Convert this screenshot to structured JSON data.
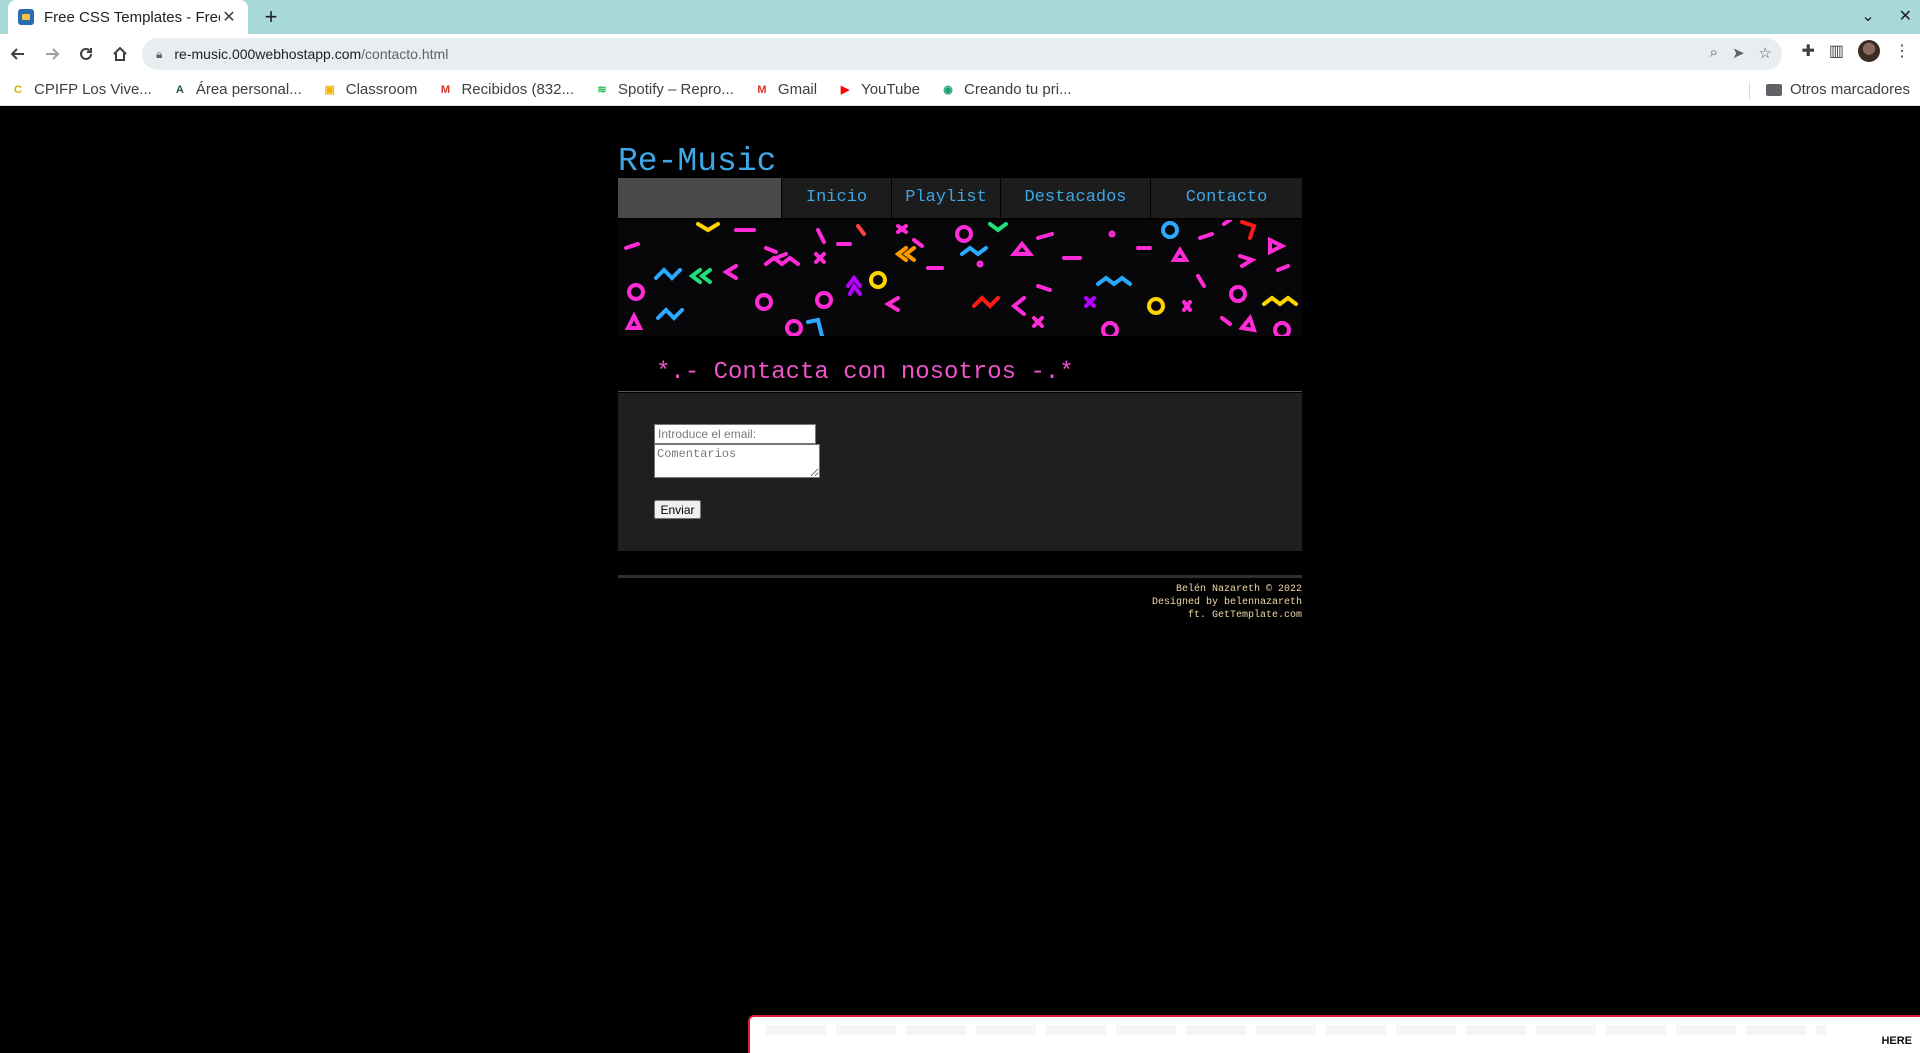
{
  "browser": {
    "tab_title": "Free CSS Templates - Free",
    "tab_close": "✕",
    "new_tab": "+",
    "url_host": "re-music.000webhostapp.com",
    "url_path": "/contacto.html",
    "bookmarks": [
      {
        "label": "CPIFP Los Vive...",
        "icon": "C",
        "color": "#e2a900"
      },
      {
        "label": "Área personal...",
        "icon": "A",
        "color": "#1e5631"
      },
      {
        "label": "Classroom",
        "icon": "▣",
        "color": "#f4b400"
      },
      {
        "label": "Recibidos (832...",
        "icon": "M",
        "color": "#d93025"
      },
      {
        "label": "Spotify – Repro...",
        "icon": "≋",
        "color": "#1db954"
      },
      {
        "label": "Gmail",
        "icon": "M",
        "color": "#d93025"
      },
      {
        "label": "YouTube",
        "icon": "▶",
        "color": "#ff0000"
      },
      {
        "label": "Creando tu pri...",
        "icon": "◉",
        "color": "#18a06b"
      }
    ],
    "other_bookmarks": "Otros marcadores"
  },
  "site": {
    "title": "Re-Music",
    "nav": [
      "Inicio",
      "Playlist",
      "Destacados",
      "Contacto"
    ],
    "heading": "*.- Contacta con nosotros -.*",
    "form": {
      "email_placeholder": "Introduce el email:",
      "comments_placeholder": "Comentarios",
      "submit_label": "Enviar"
    },
    "footer": {
      "line1": "Belén Nazareth © 2022",
      "line2": "Designed by belennazareth",
      "line3": "ft. GetTemplate.com"
    },
    "host_banner": {
      "cta": "HERE"
    }
  },
  "colors": {
    "accent_blue": "#3ea7e6",
    "heading_pink": "#ee55c8",
    "footer_text": "#f0d9a8"
  }
}
